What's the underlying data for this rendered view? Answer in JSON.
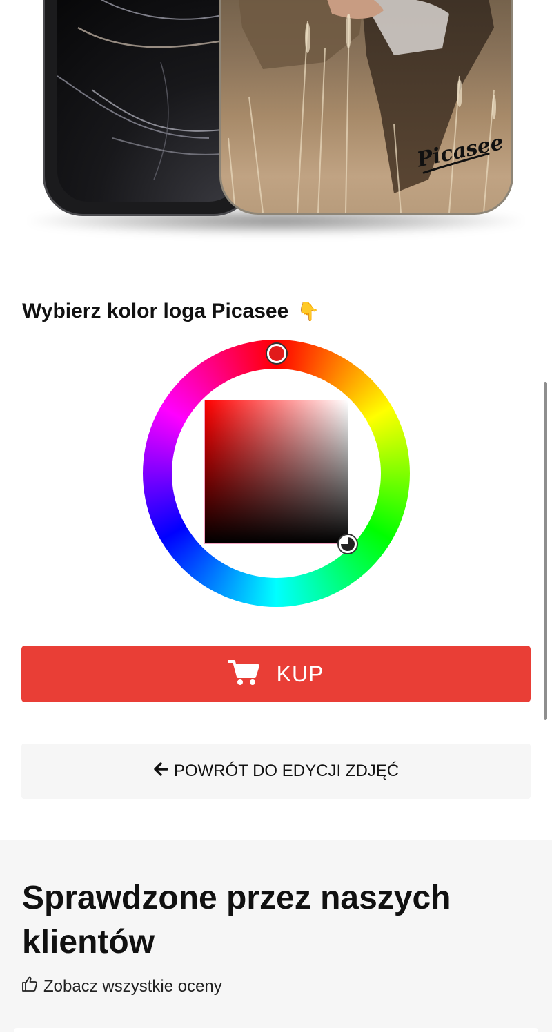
{
  "preview": {
    "case_logo_text": "Picasee"
  },
  "color_picker": {
    "title": "Wybierz kolor loga Picasee",
    "title_emoji": "👇",
    "selected_hue_color": "#ff0000"
  },
  "actions": {
    "buy_label": "KUP",
    "buy_icon": "cart-icon",
    "buy_color": "#e93e36",
    "back_label": "POWRÓT DO EDYCJI ZDJĘĆ",
    "back_icon": "arrow-left-icon"
  },
  "reviews": {
    "heading": "Sprawdzone przez naszych klientów",
    "see_all_label": "Zobacz wszystkie oceny",
    "see_all_icon": "thumbs-up-icon"
  }
}
